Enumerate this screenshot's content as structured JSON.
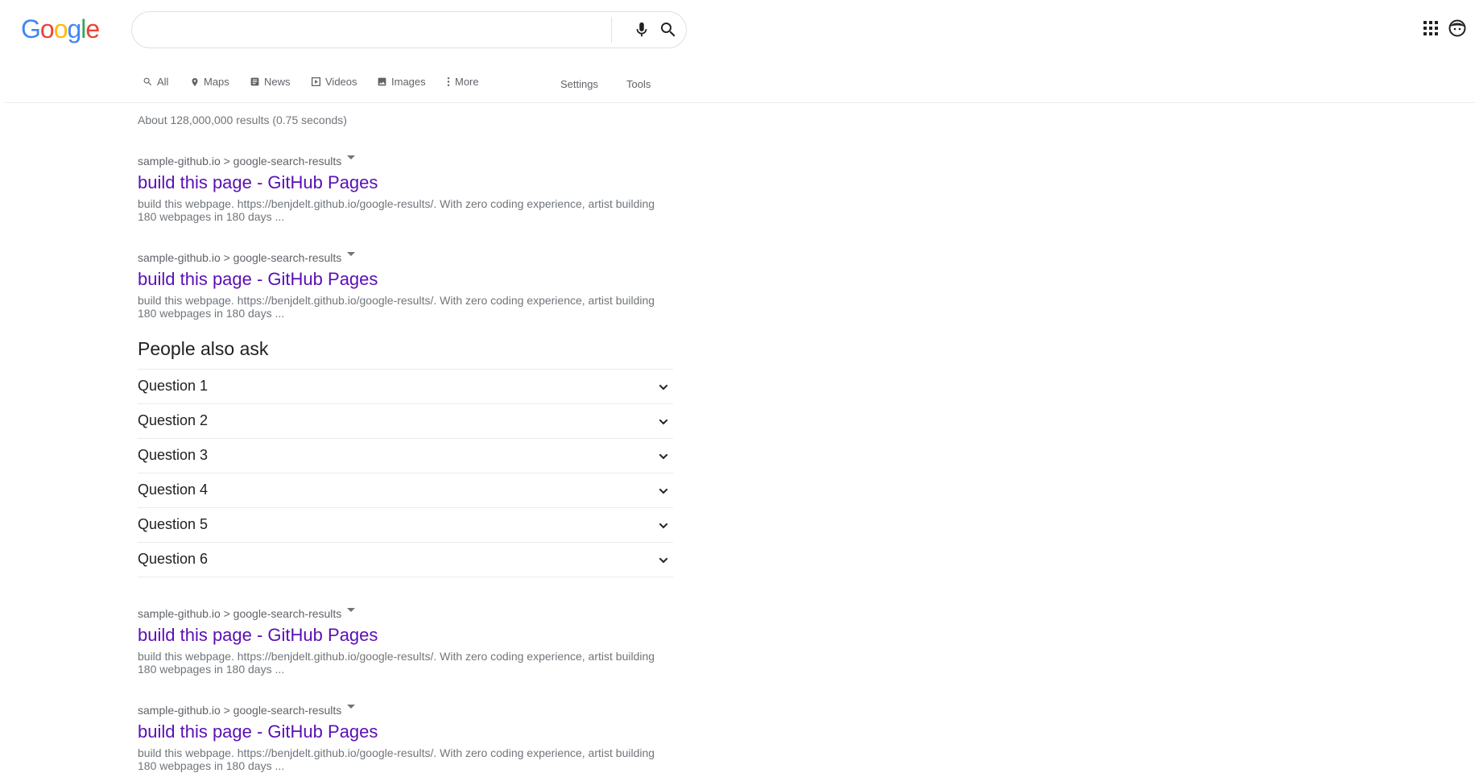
{
  "header": {
    "logo": [
      "G",
      "o",
      "o",
      "g",
      "l",
      "e"
    ],
    "logo_colors": [
      "#4285f4",
      "#ea4335",
      "#fbbc05",
      "#4285f4",
      "#34a853",
      "#ea4335"
    ],
    "search_value": "",
    "icons": [
      "mic-icon",
      "search-icon",
      "apps-icon",
      "avatar-icon"
    ]
  },
  "tabs": {
    "all": "All",
    "maps": "Maps",
    "news": "News",
    "videos": "Videos",
    "images": "Images",
    "more": "More",
    "settings": "Settings",
    "tools": "Tools"
  },
  "stats": "About 128,000,000 results (0.75 seconds)",
  "results": [
    {
      "cite": "sample-github.io > google-search-results",
      "title": "build this page - GitHub Pages",
      "snippet_line1": "build this webpage. https://benjdelt.github.io/google-results/. With zero coding experience, artist building",
      "snippet_line2": "180 webpages in 180 days ..."
    },
    {
      "cite": "sample-github.io > google-search-results",
      "title": "build this page - GitHub Pages",
      "snippet_line1": "build this webpage. https://benjdelt.github.io/google-results/. With zero coding experience, artist building",
      "snippet_line2": "180 webpages in 180 days ..."
    },
    {
      "cite": "sample-github.io > google-search-results",
      "title": "build this page - GitHub Pages",
      "snippet_line1": "build this webpage. https://benjdelt.github.io/google-results/. With zero coding experience, artist building",
      "snippet_line2": "180 webpages in 180 days ..."
    },
    {
      "cite": "sample-github.io > google-search-results",
      "title": "build this page - GitHub Pages",
      "snippet_line1": "build this webpage. https://benjdelt.github.io/google-results/. With zero coding experience, artist building",
      "snippet_line2": "180 webpages in 180 days ..."
    }
  ],
  "people_also_ask": {
    "title": "People also ask",
    "questions": [
      "Question 1",
      "Question 2",
      "Question 3",
      "Question 4",
      "Question 5",
      "Question 6"
    ]
  },
  "colors": {
    "link_visited": "#5a0fb5",
    "muted": "#70757a",
    "border": "#dfe1e5"
  }
}
